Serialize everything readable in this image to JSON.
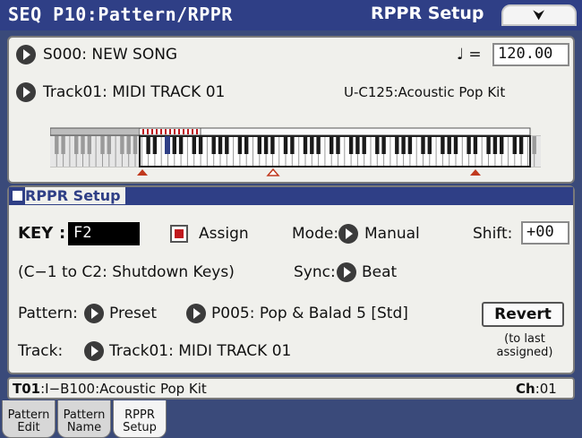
{
  "header": {
    "title": "SEQ P10:Pattern/RPPR",
    "page_name": "RPPR Setup",
    "menu_icon": "chevron-down-icon"
  },
  "song": {
    "label": "S000: NEW SONG",
    "tempo_symbol": "♩ =",
    "tempo": "120.00"
  },
  "track": {
    "label": "Track01: MIDI TRACK 01",
    "program": "U-C125:Acoustic Pop Kit"
  },
  "setup": {
    "section_title": "RPPR Setup",
    "key_label": "KEY",
    "key_value": "F2",
    "assign_label": "Assign",
    "assign_checked": true,
    "mode_label": "Mode:",
    "mode_value": "Manual",
    "shift_label": "Shift:",
    "shift_value": "+00",
    "shutdown_note": "(C−1 to C2: Shutdown Keys)",
    "sync_label": "Sync:",
    "sync_value": "Beat",
    "pattern_label": "Pattern:",
    "pattern_bank": "Preset",
    "pattern_value": "P005: Pop & Balad 5 [Std]",
    "revert_label": "Revert",
    "revert_note_line1": "(to last",
    "revert_note_line2": "assigned)",
    "track_label": "Track:",
    "track_value": "Track01: MIDI TRACK 01"
  },
  "status": {
    "prefix": "T01",
    "program": ":I−B100:Acoustic Pop Kit",
    "ch_label": "Ch",
    "ch_value": ":01"
  },
  "tabs": [
    {
      "line1": "Pattern",
      "line2": "Edit"
    },
    {
      "line1": "Pattern",
      "line2": "Name"
    },
    {
      "line1": "RPPR",
      "line2": "Setup"
    }
  ],
  "colors": {
    "title_bar": "#2f3f86",
    "key_red": "#c0191e",
    "key_marker": "#c0391e"
  }
}
